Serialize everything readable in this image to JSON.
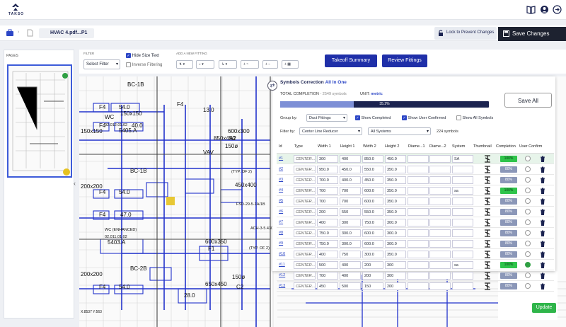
{
  "app": {
    "brand": "TAKSO"
  },
  "document": {
    "title": "HVAC 4.pdf...P1"
  },
  "docbar": {
    "lock_label": "Lock to Prevent Changes",
    "save_label": "Save Changes"
  },
  "pages": {
    "label": "PAGES"
  },
  "toolbar": {
    "filter_label": "FILTER",
    "select_filter": "Select Filter",
    "hide_size_text": "Hide Size Text",
    "inverse_filtering": "Inverse Filtering",
    "add_fitting_label": "ADD A NEW FITTING",
    "takeoff_summary": "Takeoff Summary",
    "review_fittings": "Review Fittings",
    "fit_buttons": [
      "↯ ▾",
      "⌐ ▾",
      "↳ ▾",
      "+ ~",
      "+ −",
      "+ ▦"
    ]
  },
  "panel": {
    "title": "Symbols Correction",
    "title_suffix": "All In One",
    "total_completion_label": "TOTAL COMPLETION",
    "symbol_count_text": "- 2549 symbols",
    "unit_label": "UNIT:",
    "unit_value": "metric",
    "progress_text": "35.2%",
    "progress_value": 35.2,
    "save_all": "Save All",
    "group_by_label": "Group by:",
    "group_by_value": "Duct Fittings",
    "show_completed": "Show Completed",
    "show_user_confirmed": "Show User Confirmed",
    "show_all_symbols": "Show All Symbols",
    "filter_by_label": "Filter by:",
    "filter_value": "Center Line Reducer",
    "system_value": "All Systems",
    "filtered_count": "224 symbols",
    "columns": [
      "Id",
      "Type",
      "Width 1",
      "Height 1",
      "Width 2",
      "Height 2",
      "Diame...1",
      "Diame...2",
      "System",
      "Thumbnail",
      "Completion",
      "User Confirm"
    ],
    "rows": [
      {
        "id": "#1",
        "type": "CENTER...",
        "w1": "300",
        "h1": "400",
        "w2": "850.0",
        "h2": "450.0",
        "sys": "SA",
        "comp": "100%",
        "done": true,
        "confirmed": false
      },
      {
        "id": "#2",
        "type": "CENTER...",
        "w1": "950.0",
        "h1": "450.0",
        "w2": "550.0",
        "h2": "350.0",
        "sys": "",
        "comp": "80%",
        "done": false,
        "confirmed": false
      },
      {
        "id": "#3",
        "type": "CENTER...",
        "w1": "700.0",
        "h1": "400.0",
        "w2": "450.0",
        "h2": "350.0",
        "sys": "",
        "comp": "80%",
        "done": false,
        "confirmed": false
      },
      {
        "id": "#4",
        "type": "CENTER...",
        "w1": "700",
        "h1": "700",
        "w2": "600.0",
        "h2": "350.0",
        "sys": "sa",
        "comp": "100%",
        "done": true,
        "confirmed": false
      },
      {
        "id": "#5",
        "type": "CENTER...",
        "w1": "700",
        "h1": "700",
        "w2": "600.0",
        "h2": "350.0",
        "sys": "",
        "comp": "80%",
        "done": false,
        "confirmed": false
      },
      {
        "id": "#6",
        "type": "CENTER...",
        "w1": "200",
        "h1": "550",
        "w2": "550.0",
        "h2": "350.0",
        "sys": "",
        "comp": "80%",
        "done": false,
        "confirmed": false
      },
      {
        "id": "#7",
        "type": "CENTER...",
        "w1": "400",
        "h1": "300",
        "w2": "750.0",
        "h2": "300.0",
        "sys": "",
        "comp": "80%",
        "done": false,
        "confirmed": false
      },
      {
        "id": "#8",
        "type": "CENTER...",
        "w1": "750.0",
        "h1": "300.0",
        "w2": "600.0",
        "h2": "300.0",
        "sys": "",
        "comp": "80%",
        "done": false,
        "confirmed": false
      },
      {
        "id": "#9",
        "type": "CENTER...",
        "w1": "750.0",
        "h1": "300.0",
        "w2": "600.0",
        "h2": "300.0",
        "sys": "",
        "comp": "80%",
        "done": false,
        "confirmed": false
      },
      {
        "id": "#10",
        "type": "CENTER...",
        "w1": "400",
        "h1": "750",
        "w2": "300.0",
        "h2": "350.0",
        "sys": "",
        "comp": "80%",
        "done": false,
        "confirmed": false
      },
      {
        "id": "#11",
        "type": "CENTER...",
        "w1": "500",
        "h1": "400",
        "w2": "200",
        "h2": "300",
        "sys": "sa",
        "comp": "100%",
        "done": true,
        "confirmed": true
      },
      {
        "id": "#12",
        "type": "CENTER...",
        "w1": "700",
        "h1": "400",
        "w2": "200",
        "h2": "300",
        "sys": "",
        "comp": "80%",
        "done": false,
        "confirmed": false
      },
      {
        "id": "#13",
        "type": "CENTER...",
        "w1": "450",
        "h1": "500",
        "w2": "150",
        "h2": "200",
        "sys": "",
        "comp": "80%",
        "done": false,
        "confirmed": false
      }
    ]
  },
  "side": {
    "update_label": "Update"
  },
  "canvas": {
    "coords": "X:8537 Y:563",
    "labels": [
      "BC-1B",
      "F4",
      "54.0",
      "150x150",
      "F4",
      "40.0",
      "150x150",
      "WC",
      "02.012.01.02",
      "5405.A",
      "F4",
      "54.0",
      "200x200",
      "BC-1B",
      "F4",
      "47.0",
      "WC (ENHANCED)",
      "02.011.01.02",
      "5403.A",
      "200x200",
      "BC-2B",
      "F4",
      "54.0",
      "F4",
      "13.0",
      "600x300",
      "A2",
      "150ø",
      "(TYP. OF 2)",
      "450x400",
      "FSD-29-5-1A/1B",
      "ACH-3-5.4300",
      "600x350",
      "F1",
      "(TYP. OF 2)",
      "650x450",
      "150ø",
      "C2",
      "28.0",
      "850x450",
      "VAV",
      "R10/2L"
    ]
  }
}
